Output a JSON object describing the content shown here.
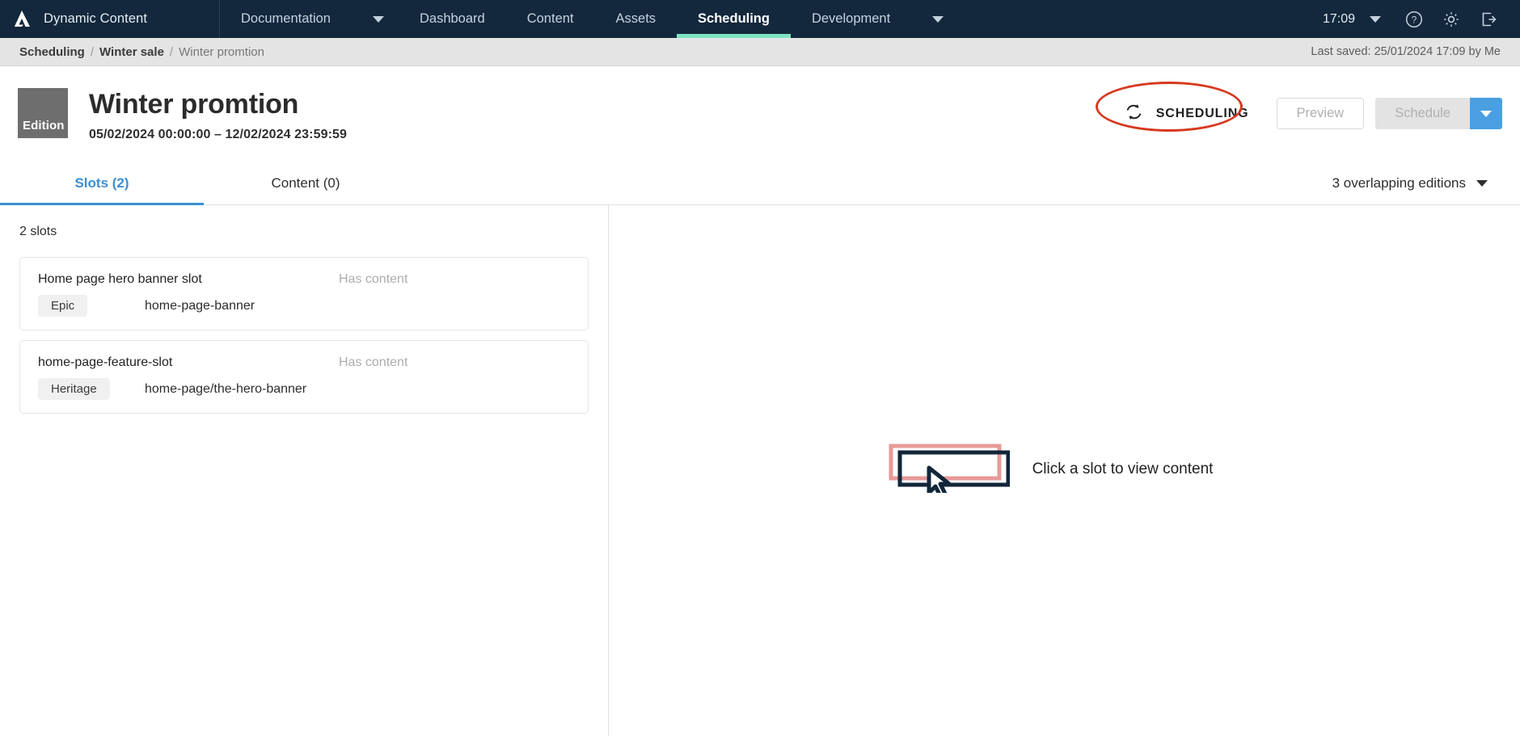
{
  "topnav": {
    "brand": "Dynamic Content",
    "logo_icon": "amplience-logo-icon",
    "items": [
      {
        "label": "Documentation",
        "has_caret": true,
        "active": false
      },
      {
        "label": "Dashboard",
        "has_caret": false,
        "active": false
      },
      {
        "label": "Content",
        "has_caret": false,
        "active": false
      },
      {
        "label": "Assets",
        "has_caret": false,
        "active": false
      },
      {
        "label": "Scheduling",
        "has_caret": false,
        "active": true
      },
      {
        "label": "Development",
        "has_caret": true,
        "active": false
      }
    ],
    "clock": "17:09",
    "clock_caret_icon": "chevron-down-icon",
    "help_icon": "help-circle-icon",
    "settings_icon": "gear-icon",
    "logout_icon": "logout-icon",
    "accent_active": "#7fe3c0",
    "background": "#13283c"
  },
  "breadcrumb": {
    "items": [
      "Scheduling",
      "Winter sale",
      "Winter promtion"
    ],
    "separator": "/",
    "last_saved": "Last saved: 25/01/2024 17:09 by Me"
  },
  "header": {
    "badge_label": "Edition",
    "title": "Winter promtion",
    "date_range": "05/02/2024 00:00:00  –  12/02/2024 23:59:59",
    "status_label": "SCHEDULING",
    "status_icon": "sync-refresh-icon",
    "annotation_color": "#d6391f",
    "preview_label": "Preview",
    "schedule_label": "Schedule",
    "schedule_caret_icon": "chevron-down-icon",
    "schedule_caret_color": "#4a9fe0"
  },
  "tabs": [
    {
      "label": "Slots (2)",
      "active": true
    },
    {
      "label": "Content (0)",
      "active": false
    }
  ],
  "overlapping": {
    "label": "3 overlapping editions",
    "caret_icon": "chevron-down-icon"
  },
  "left_panel": {
    "count_label": "2 slots",
    "slots": [
      {
        "name": "Home page hero banner slot",
        "status": "Has content",
        "tag": "Epic",
        "key": "home-page-banner"
      },
      {
        "name": "home-page-feature-slot",
        "status": "Has content",
        "tag": "Heritage",
        "key": "home-page/the-hero-banner"
      }
    ]
  },
  "right_panel": {
    "empty_icon": "click-slot-cursor-icon",
    "empty_text": "Click a slot to view content"
  }
}
